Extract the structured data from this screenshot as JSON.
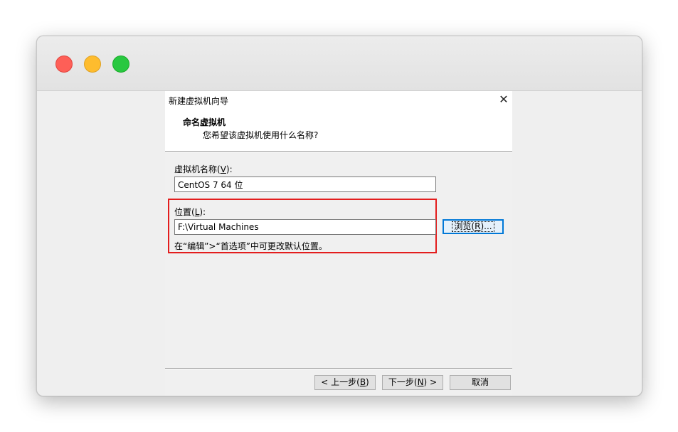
{
  "window": {
    "traffic_lights": [
      "close",
      "minimize",
      "zoom"
    ]
  },
  "dialog": {
    "title": "新建虚拟机向导",
    "heading": "命名虚拟机",
    "subtitle": "您希望该虚拟机使用什么名称?",
    "name_field": {
      "label_prefix": "虚拟机名称(",
      "label_key": "V",
      "label_suffix": "):",
      "value": "CentOS 7 64 位"
    },
    "location_field": {
      "label_prefix": "位置(",
      "label_key": "L",
      "label_suffix": "):",
      "value": "F:\\Virtual Machines"
    },
    "browse_button": {
      "prefix": "浏览(",
      "key": "R",
      "suffix": ")..."
    },
    "hint": "在“编辑”>“首选项”中可更改默认位置。",
    "buttons": {
      "back": {
        "prefix": "< 上一步(",
        "key": "B",
        "suffix": ")"
      },
      "next": {
        "prefix": "下一步(",
        "key": "N",
        "suffix": ") >"
      },
      "cancel": "取消"
    }
  },
  "colors": {
    "highlight_border": "#e31d1d",
    "focus_border": "#0078d7"
  }
}
